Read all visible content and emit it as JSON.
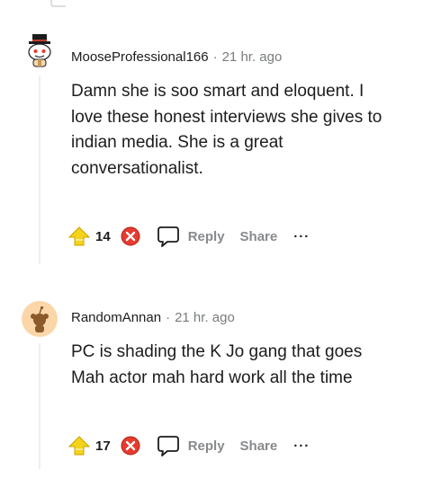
{
  "comments": [
    {
      "author": "MooseProfessional166",
      "separator": "·",
      "time": "21 hr. ago",
      "body": "Damn she is soo smart and eloquent. I love these honest interviews she gives to indian media. She is a great conversationalist.",
      "score": "14",
      "reply_label": "Reply",
      "share_label": "Share",
      "more_label": "···",
      "avatar_icon": "snoo-top-hat-avatar-icon"
    },
    {
      "author": "RandomAnnan",
      "separator": "·",
      "time": "21 hr. ago",
      "body": "PC is shading the K Jo gang that goes Mah actor mah hard work all the time",
      "score": "17",
      "reply_label": "Reply",
      "share_label": "Share",
      "more_label": "···",
      "avatar_icon": "snoo-default-avatar-icon"
    }
  ],
  "colors": {
    "upvote": "#f5d31a",
    "downvote": "#e63b2e",
    "muted": "#878a8c",
    "thread_line": "#edeff1"
  }
}
